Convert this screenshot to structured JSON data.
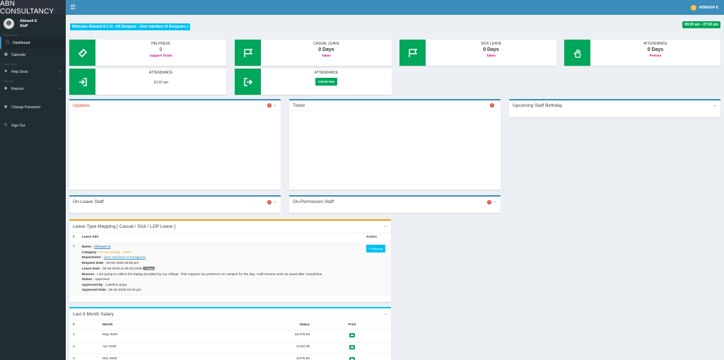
{
  "header": {
    "brand": "ABN CONSULTANCY",
    "menu_icon": "bars-icon",
    "user": "ABINASH E"
  },
  "sidebar": {
    "user": {
      "name": "Abinash E",
      "role": "Staff"
    },
    "headers": {
      "dashboard": "Dashboard",
      "helpdesk": "Help Desk",
      "reports": "Reports"
    },
    "items": [
      {
        "label": "Dashboard",
        "icon": "dashboard-icon"
      },
      {
        "label": "Calendar",
        "icon": "calendar-icon"
      },
      {
        "label": "Help Desk",
        "icon": "ticket-icon"
      },
      {
        "label": "Reports",
        "icon": "circle-icon"
      },
      {
        "label": "Change Password",
        "icon": "key-icon"
      },
      {
        "label": "Sign Out",
        "icon": "sign-out-icon"
      }
    ]
  },
  "welcome": "Welcome Abinash E [ UI - UX Designer - User Interface UI Designers ]",
  "shift": "09:00 am - 07:00 pm",
  "infoboxes": [
    {
      "title": "HELPDESK",
      "value": "0",
      "sub": "Support Ticket",
      "icon": "ticket-icon"
    },
    {
      "title": "CASUAL LEAVE",
      "value": "0 Days",
      "sub": "Taken",
      "icon": "flag-icon"
    },
    {
      "title": "SICK LEAVE",
      "value": "0 Days",
      "sub": "Taken",
      "icon": "flag-icon"
    },
    {
      "title": "ATTENDANCE",
      "value": "0 Days",
      "sub": "Present",
      "icon": "hand-icon"
    },
    {
      "title": "ATTENDANCE",
      "value": "10:10 am",
      "icon": "sign-in-icon"
    },
    {
      "title": "ATTENDANCE",
      "button": "Check-Out",
      "icon": "sign-out-icon"
    }
  ],
  "boxes": {
    "updates": {
      "title": "Updates",
      "count": "0"
    },
    "ticket": {
      "title": "Ticket",
      "count": "0"
    },
    "birthday": {
      "title": "Upcoming Staff Birthday"
    },
    "onleave": {
      "title": "On-Leave Staff",
      "count": "0"
    },
    "onpermission": {
      "title": "On-Permission Staff",
      "count": "0"
    }
  },
  "leave": {
    "title": "Leave Type Mapping [ Casual / Sick / LOP Leave ]",
    "headers": {
      "num": "#",
      "info": "Leave Info",
      "action": "Action"
    },
    "row": {
      "num": "1",
      "name_label": "Name : ",
      "name": "Abinash E",
      "category_label": "Category : ",
      "category": "UI-UX Design - Team",
      "department_label": "Department : ",
      "department": "User Interface UI Designers",
      "request_date_label": "Request Date",
      "request_date": " : 04-02-2026 06:56 pm",
      "leave_date_label": "Leave Date",
      "leave_date": " : 05-02-2026 to 05-02-2026",
      "leave_days": "1 Days",
      "reason_label": "Reason",
      "reason": " : I am going to collect the laptop provided by my college. This requires my presence on campus for the day. I will resume work as usual after completion.",
      "status_label": "Status",
      "status": " : Approved",
      "approved_by_label": "Approved By",
      "approved_by": " : Lakshmi priya",
      "approved_date_label": "Approved Date",
      "approved_date": " : 05-02-2026 04:34 pm",
      "action": "P Mapping"
    }
  },
  "salary": {
    "title": "Last 6 Month Salary",
    "headers": {
      "num": "#",
      "month": "Month",
      "salary": "Salary",
      "print": "Print"
    },
    "rows": [
      {
        "num": "1",
        "month": "May 2026",
        "salary": "15,076.53"
      },
      {
        "num": "2",
        "month": "Apr 2026",
        "salary": "9,610.38"
      },
      {
        "num": "3",
        "month": "Mar 2026",
        "salary": "8,076.50"
      }
    ]
  }
}
